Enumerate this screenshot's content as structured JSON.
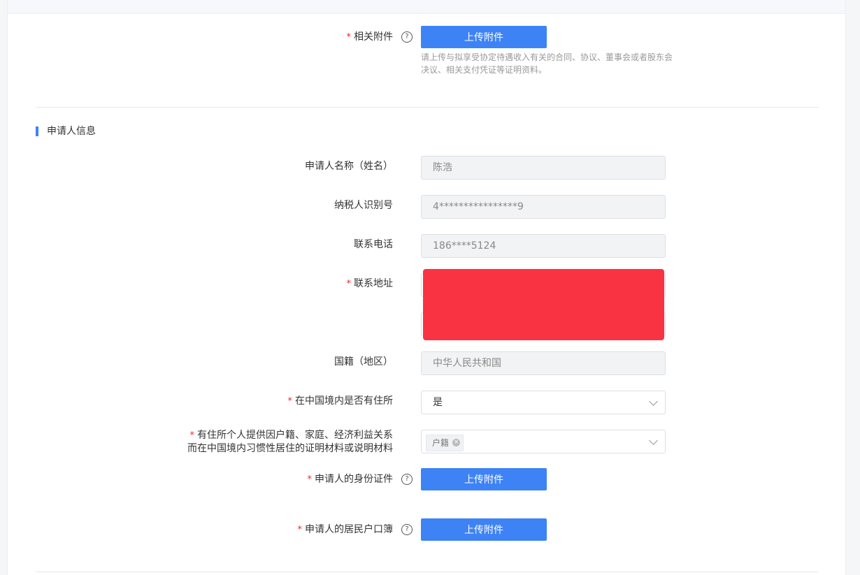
{
  "attachments": {
    "label": "相关附件",
    "required": "*",
    "help": "?",
    "button": "上传附件",
    "hint": "请上传与拟享受协定待遇收入有关的合同、协议、董事会或者股东会决议、相关支付凭证等证明资料。"
  },
  "applicant": {
    "section_title": "申请人信息",
    "name": {
      "label": "申请人名称（姓名）",
      "value": "陈浩"
    },
    "tax_id": {
      "label": "纳税人识别号",
      "value": "4****************9"
    },
    "phone": {
      "label": "联系电话",
      "value": "186****5124"
    },
    "address": {
      "label": "联系地址",
      "required": "*"
    },
    "nationality": {
      "label": "国籍（地区）",
      "value": "中华人民共和国"
    },
    "residence": {
      "label": "在中国境内是否有住所",
      "required": "*",
      "value": "是"
    },
    "proof": {
      "label_line1": "有住所个人提供因户籍、家庭、经济利益关系",
      "label_line2": "而在中国境内习惯性居住的证明材料或说明材料",
      "required": "*",
      "tag": "户籍"
    },
    "id_doc": {
      "label": "申请人的身份证件",
      "required": "*",
      "help": "?",
      "button": "上传附件"
    },
    "household": {
      "label": "申请人的居民户口簿",
      "required": "*",
      "help": "?",
      "button": "上传附件"
    }
  }
}
